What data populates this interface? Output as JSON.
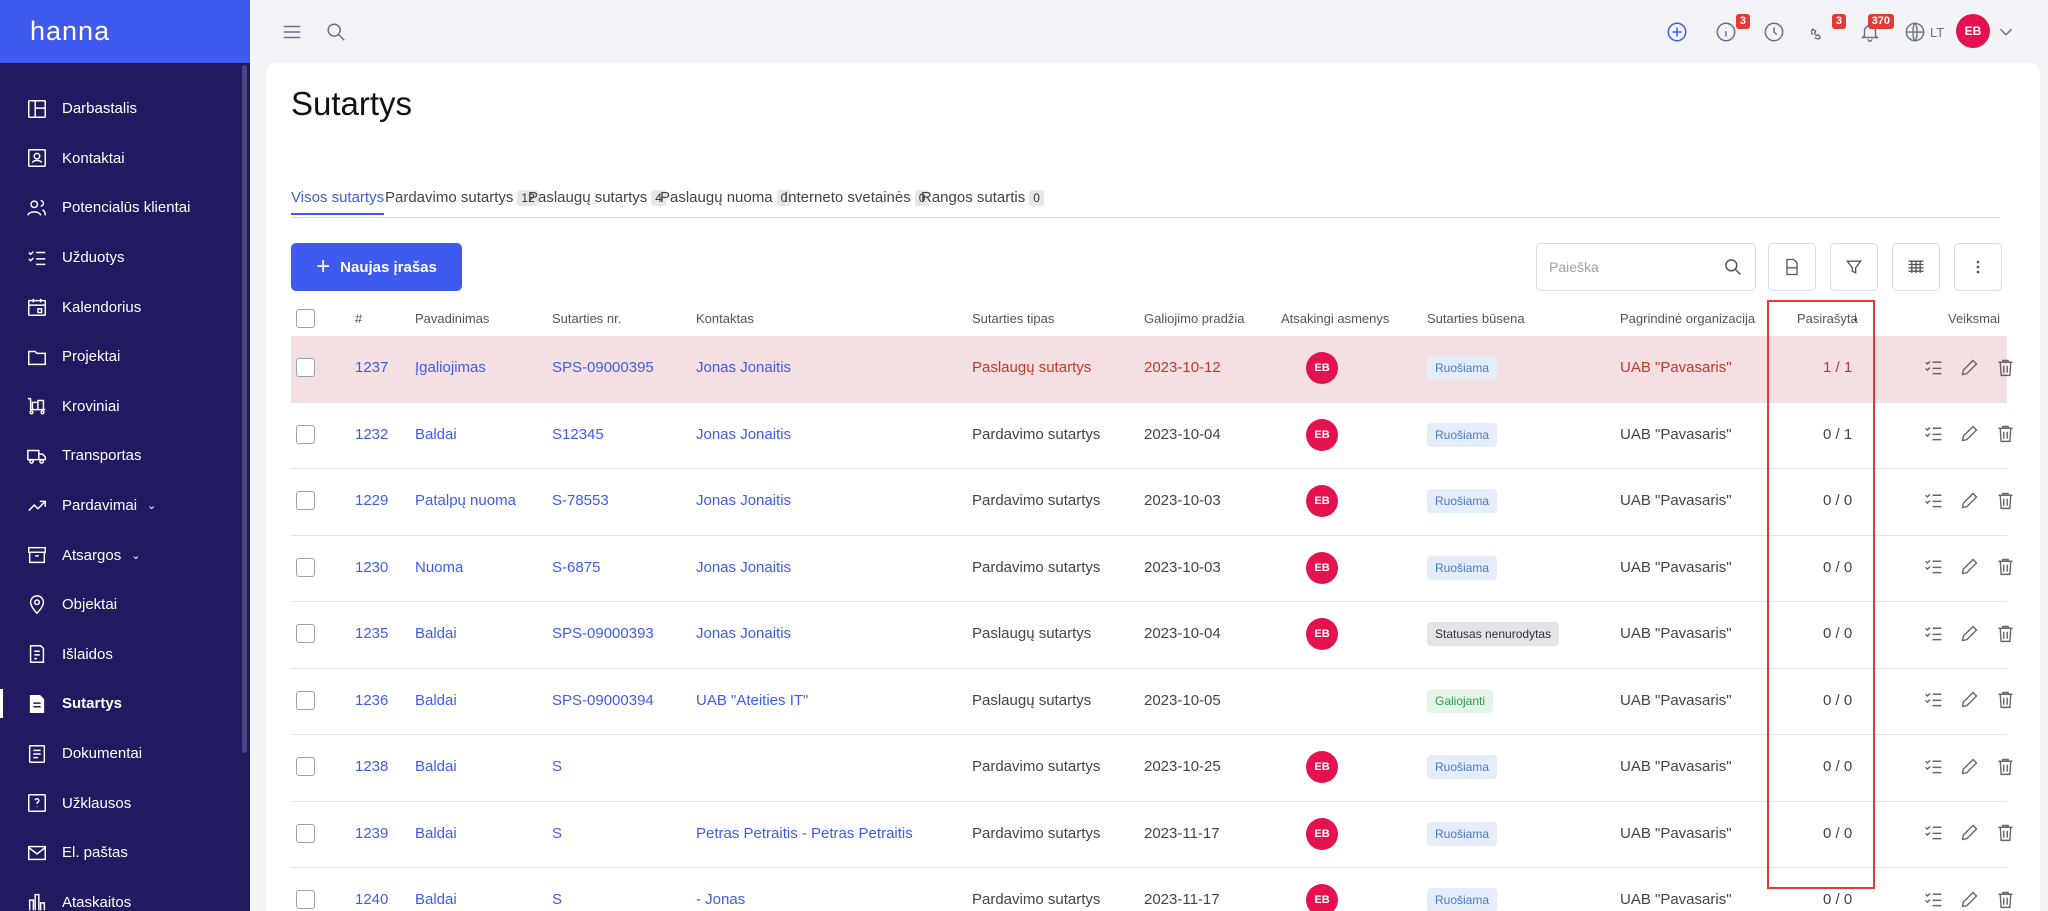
{
  "app": {
    "logo": "hanna"
  },
  "sidebar": {
    "items": [
      {
        "label": "Darbastalis",
        "icon": "dashboard-icon"
      },
      {
        "label": "Kontaktai",
        "icon": "contacts-icon"
      },
      {
        "label": "Potencialūs klientai",
        "icon": "leads-icon"
      },
      {
        "label": "Užduotys",
        "icon": "tasks-icon"
      },
      {
        "label": "Kalendorius",
        "icon": "calendar-icon"
      },
      {
        "label": "Projektai",
        "icon": "folder-icon"
      },
      {
        "label": "Kroviniai",
        "icon": "cargo-icon"
      },
      {
        "label": "Transportas",
        "icon": "truck-icon"
      },
      {
        "label": "Pardavimai",
        "icon": "sales-icon",
        "expandable": true
      },
      {
        "label": "Atsargos",
        "icon": "inventory-icon",
        "expandable": true
      },
      {
        "label": "Objektai",
        "icon": "location-icon"
      },
      {
        "label": "Išlaidos",
        "icon": "expenses-icon"
      },
      {
        "label": "Sutartys",
        "icon": "contract-icon",
        "active": true
      },
      {
        "label": "Dokumentai",
        "icon": "documents-icon"
      },
      {
        "label": "Užklausos",
        "icon": "inquiries-icon"
      },
      {
        "label": "El. paštas",
        "icon": "mail-icon"
      },
      {
        "label": "Ataskaitos",
        "icon": "reports-icon"
      }
    ]
  },
  "topbar": {
    "info_badge": "3",
    "phone_badge": "3",
    "notifications_badge": "370",
    "language": "LT",
    "user_initials": "EB"
  },
  "page": {
    "title": "Sutartys",
    "tabs": [
      {
        "label": "Visos sutartys",
        "count": ""
      },
      {
        "label": "Pardavimo sutartys",
        "count": "12"
      },
      {
        "label": "Paslaugų sutartys",
        "count": "4"
      },
      {
        "label": "Paslaugų nuoma",
        "count": "0"
      },
      {
        "label": "Interneto svetainės",
        "count": "0"
      },
      {
        "label": "Rangos sutartis",
        "count": "0"
      }
    ],
    "new_button": "Naujas įrašas",
    "search_placeholder": "Paieška"
  },
  "table": {
    "headers": {
      "num": "#",
      "name": "Pavadinimas",
      "contract_no": "Sutarties nr.",
      "contact": "Kontaktas",
      "type": "Sutarties tipas",
      "start": "Galiojimo pradžia",
      "responsible": "Atsakingi asmenys",
      "status": "Sutarties būsena",
      "org": "Pagrindinė organizacija",
      "signed": "Pasirašyta",
      "actions": "Veiksmai"
    },
    "rows": [
      {
        "id": "1237",
        "name": "Įgaliojimas",
        "contract_no": "SPS-09000395",
        "contact": "Jonas Jonaitis",
        "type": "Paslaugų sutartys",
        "start": "2023-10-12",
        "responsible": "EB",
        "status": "Ruošiama",
        "org": "UAB \"Pavasaris\"",
        "signed": "1 / 1"
      },
      {
        "id": "1232",
        "name": "Baldai",
        "contract_no": "S12345",
        "contact": "Jonas Jonaitis",
        "type": "Pardavimo sutartys",
        "start": "2023-10-04",
        "responsible": "EB",
        "status": "Ruošiama",
        "org": "UAB \"Pavasaris\"",
        "signed": "0 / 1"
      },
      {
        "id": "1229",
        "name": "Patalpų nuoma",
        "contract_no": "S-78553",
        "contact": "Jonas Jonaitis",
        "type": "Pardavimo sutartys",
        "start": "2023-10-03",
        "responsible": "EB",
        "status": "Ruošiama",
        "org": "UAB \"Pavasaris\"",
        "signed": "0 / 0"
      },
      {
        "id": "1230",
        "name": "Nuoma",
        "contract_no": "S-6875",
        "contact": "Jonas Jonaitis",
        "type": "Pardavimo sutartys",
        "start": "2023-10-03",
        "responsible": "EB",
        "status": "Ruošiama",
        "org": "UAB \"Pavasaris\"",
        "signed": "0 / 0"
      },
      {
        "id": "1235",
        "name": "Baldai",
        "contract_no": "SPS-09000393",
        "contact": "Jonas Jonaitis",
        "type": "Paslaugų sutartys",
        "start": "2023-10-04",
        "responsible": "EB",
        "status": "Statusas nenurodytas",
        "org": "UAB \"Pavasaris\"",
        "signed": "0 / 0"
      },
      {
        "id": "1236",
        "name": "Baldai",
        "contract_no": "SPS-09000394",
        "contact": "UAB \"Ateities IT\"",
        "type": "Paslaugų sutartys",
        "start": "2023-10-05",
        "responsible": "",
        "status": "Galiojanti",
        "org": "UAB \"Pavasaris\"",
        "signed": "0 / 0"
      },
      {
        "id": "1238",
        "name": "Baldai",
        "contract_no": "S",
        "contact": "",
        "type": "Pardavimo sutartys",
        "start": "2023-10-25",
        "responsible": "EB",
        "status": "Ruošiama",
        "org": "UAB \"Pavasaris\"",
        "signed": "0 / 0"
      },
      {
        "id": "1239",
        "name": "Baldai",
        "contract_no": "S",
        "contact": "Petras Petraitis - Petras Petraitis",
        "type": "Pardavimo sutartys",
        "start": "2023-11-17",
        "responsible": "EB",
        "status": "Ruošiama",
        "org": "UAB \"Pavasaris\"",
        "signed": "0 / 0"
      },
      {
        "id": "1240",
        "name": "Baldai",
        "contract_no": "S",
        "contact": "- Jonas",
        "type": "Pardavimo sutartys",
        "start": "2023-11-17",
        "responsible": "EB",
        "status": "Ruošiama",
        "org": "UAB \"Pavasaris\"",
        "signed": "0 / 0"
      }
    ]
  }
}
